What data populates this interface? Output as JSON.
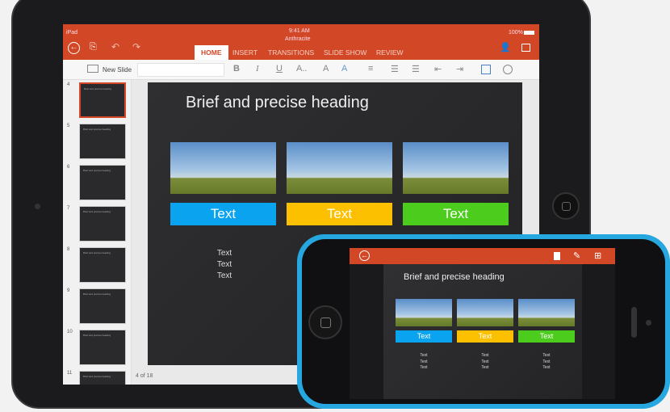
{
  "status": {
    "carrier": "iPad",
    "time": "9:41 AM",
    "battery": "100%"
  },
  "document_title": "Anthracite",
  "tabs": [
    {
      "label": "HOME",
      "active": true
    },
    {
      "label": "INSERT"
    },
    {
      "label": "TRANSITIONS"
    },
    {
      "label": "SLIDE SHOW"
    },
    {
      "label": "REVIEW"
    }
  ],
  "ribbon": {
    "new_slide": "New Slide",
    "bold": "B",
    "italic": "I",
    "underline": "U",
    "font_size": "A..",
    "font_color": "A",
    "highlight": "A"
  },
  "thumbnails": [
    {
      "n": "4",
      "title": "Brief and precise heading",
      "selected": true
    },
    {
      "n": "5",
      "title": "Brief and precise heading"
    },
    {
      "n": "6",
      "title": "Brief and precise heading"
    },
    {
      "n": "7",
      "title": "Brief and precise heading"
    },
    {
      "n": "8",
      "title": "Brief and precise heading"
    },
    {
      "n": "9",
      "title": "Brief and precise heading"
    },
    {
      "n": "10",
      "title": "Brief and precise heading"
    },
    {
      "n": "11",
      "title": "Brief and precise heading"
    }
  ],
  "slide": {
    "heading": "Brief and precise heading",
    "labels": [
      "Text",
      "Text",
      "Text"
    ],
    "label_colors": [
      "#0aa3f0",
      "#fdc000",
      "#4ccc1c"
    ],
    "bullets": [
      "Text",
      "Text",
      "Text"
    ]
  },
  "slide_counter": "4 of 18",
  "accent": "#d24726",
  "phone_frame_color": "#27a7e0"
}
